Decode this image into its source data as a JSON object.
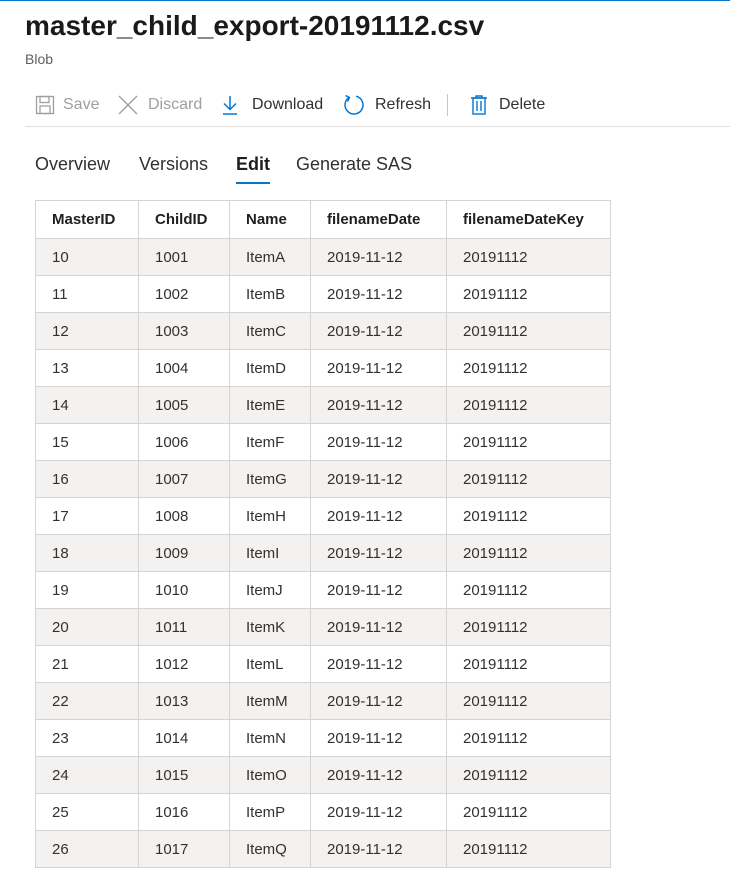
{
  "blob": {
    "title": "master_child_export-20191112.csv",
    "type": "Blob"
  },
  "toolbar": {
    "save_label": "Save",
    "discard_label": "Discard",
    "download_label": "Download",
    "refresh_label": "Refresh",
    "delete_label": "Delete"
  },
  "tabs": [
    {
      "label": "Overview",
      "selected": false
    },
    {
      "label": "Versions",
      "selected": false
    },
    {
      "label": "Edit",
      "selected": true
    },
    {
      "label": "Generate SAS",
      "selected": false
    }
  ],
  "table": {
    "columns": [
      "MasterID",
      "ChildID",
      "Name",
      "filenameDate",
      "filenameDateKey"
    ],
    "rows": [
      [
        "10",
        "1001",
        "ItemA",
        "2019-11-12",
        "20191112"
      ],
      [
        "11",
        "1002",
        "ItemB",
        "2019-11-12",
        "20191112"
      ],
      [
        "12",
        "1003",
        "ItemC",
        "2019-11-12",
        "20191112"
      ],
      [
        "13",
        "1004",
        "ItemD",
        "2019-11-12",
        "20191112"
      ],
      [
        "14",
        "1005",
        "ItemE",
        "2019-11-12",
        "20191112"
      ],
      [
        "15",
        "1006",
        "ItemF",
        "2019-11-12",
        "20191112"
      ],
      [
        "16",
        "1007",
        "ItemG",
        "2019-11-12",
        "20191112"
      ],
      [
        "17",
        "1008",
        "ItemH",
        "2019-11-12",
        "20191112"
      ],
      [
        "18",
        "1009",
        "ItemI",
        "2019-11-12",
        "20191112"
      ],
      [
        "19",
        "1010",
        "ItemJ",
        "2019-11-12",
        "20191112"
      ],
      [
        "20",
        "1011",
        "ItemK",
        "2019-11-12",
        "20191112"
      ],
      [
        "21",
        "1012",
        "ItemL",
        "2019-11-12",
        "20191112"
      ],
      [
        "22",
        "1013",
        "ItemM",
        "2019-11-12",
        "20191112"
      ],
      [
        "23",
        "1014",
        "ItemN",
        "2019-11-12",
        "20191112"
      ],
      [
        "24",
        "1015",
        "ItemO",
        "2019-11-12",
        "20191112"
      ],
      [
        "25",
        "1016",
        "ItemP",
        "2019-11-12",
        "20191112"
      ],
      [
        "26",
        "1017",
        "ItemQ",
        "2019-11-12",
        "20191112"
      ]
    ]
  },
  "icons": {
    "save": "save-icon",
    "discard": "close-icon",
    "download": "download-icon",
    "refresh": "refresh-icon",
    "delete": "trash-icon"
  },
  "colors": {
    "accent": "#0078d4",
    "disabled": "#a19f9d",
    "row_alt": "#f3f2f1"
  }
}
